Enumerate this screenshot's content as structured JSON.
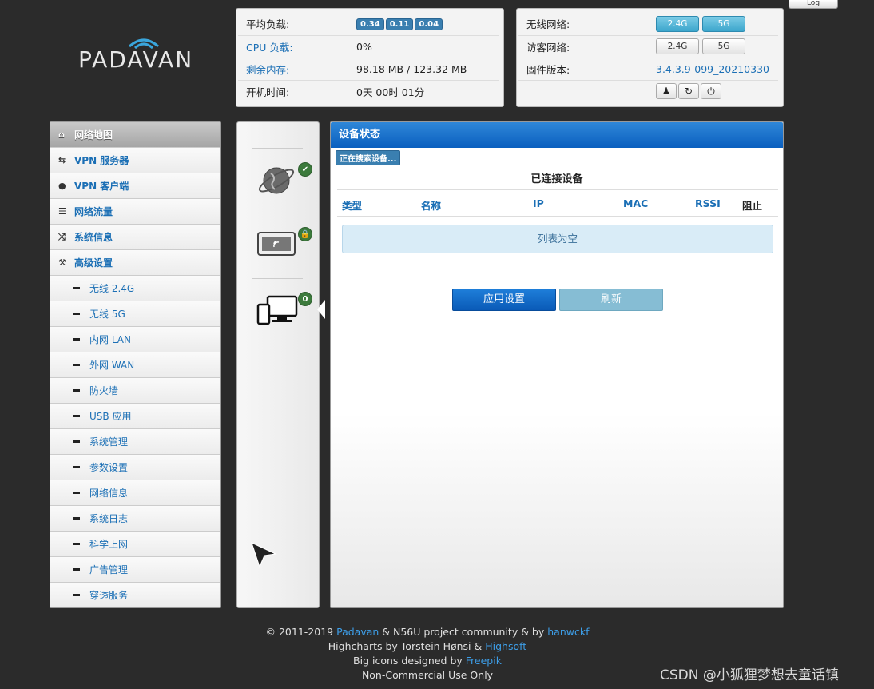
{
  "logout_label": "Log",
  "logo_text": "PADAVAN",
  "status_panel": {
    "rows": [
      {
        "label": "平均负载:",
        "badges": [
          "0.34",
          "0.11",
          "0.04"
        ]
      },
      {
        "label": "CPU 负载:",
        "value": "0%"
      },
      {
        "label": "剩余内存:",
        "value": "98.18 MB / 123.32 MB"
      },
      {
        "label": "开机时间:",
        "value": "0天 00时 01分"
      }
    ]
  },
  "wifi_panel": {
    "wireless_label": "无线网络:",
    "guest_label": "访客网络:",
    "firmware_label": "固件版本:",
    "firmware_value": "3.4.3.9-099_20210330",
    "btn_24g": "2.4G",
    "btn_5g": "5G",
    "icons": [
      "user-icon",
      "refresh-icon",
      "power-icon"
    ]
  },
  "sidebar": {
    "items": [
      {
        "label": "网络地图",
        "icon": "home-icon",
        "active": true
      },
      {
        "label": "VPN 服务器",
        "icon": "sync-icon"
      },
      {
        "label": "VPN 客户端",
        "icon": "globe-icon"
      },
      {
        "label": "网络流量",
        "icon": "list-icon"
      },
      {
        "label": "系统信息",
        "icon": "shuffle-icon"
      },
      {
        "label": "高级设置",
        "icon": "wrench-icon"
      }
    ],
    "sub_items": [
      "无线 2.4G",
      "无线 5G",
      "内网 LAN",
      "外网 WAN",
      "防火墙",
      "USB 应用",
      "系统管理",
      "参数设置",
      "网络信息",
      "系统日志",
      "科学上网",
      "广告管理",
      "穿透服务"
    ]
  },
  "icon_column": {
    "client_count": "0"
  },
  "main": {
    "header": "设备状态",
    "searching": "正在搜索设备...",
    "connected_title": "已连接设备",
    "columns": [
      "类型",
      "名称",
      "IP",
      "MAC",
      "RSSI",
      "阻止"
    ],
    "empty_text": "列表为空",
    "apply_label": "应用设置",
    "refresh_label": "刷新"
  },
  "footer": {
    "line1_prefix": "© 2011-2019 ",
    "line1_link1": "Padavan",
    "line1_mid": " & N56U project community & by ",
    "line1_link2": "hanwckf",
    "line2_prefix": "Highcharts by Torstein Hønsi & ",
    "line2_link": "Highsoft",
    "line3_prefix": "Big icons designed by ",
    "line3_link": "Freepik",
    "line4": "Non-Commercial Use Only"
  },
  "watermark": "CSDN @小狐狸梦想去童话镇",
  "colors": {
    "accent": "#0a5fbf",
    "link": "#1b6fb5",
    "status_ok": "#3c7a3c"
  }
}
